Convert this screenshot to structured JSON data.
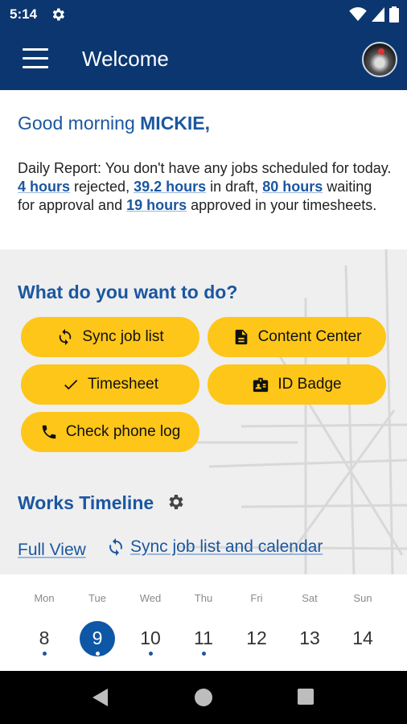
{
  "status_bar": {
    "time": "5:14"
  },
  "app_bar": {
    "title": "Welcome"
  },
  "greeting": {
    "salutation": "Good morning",
    "name": "MICKIE,"
  },
  "daily_report": {
    "intro": "Daily Report:  You don't have any jobs scheduled for today.",
    "rejected_hours": "4 hours",
    "rejected_label": "rejected,",
    "draft_hours": "39.2 hours",
    "draft_label": "in draft,",
    "waiting_hours": "80 hours",
    "waiting_label": "waiting for approval and",
    "approved_hours": "19 hours",
    "approved_label": "approved in your timesheets."
  },
  "actions": {
    "title": "What do you want to do?",
    "buttons": [
      {
        "label": "Sync job list",
        "icon": "sync-icon"
      },
      {
        "label": "Content Center",
        "icon": "document-icon"
      },
      {
        "label": "Timesheet",
        "icon": "check-icon"
      },
      {
        "label": "ID Badge",
        "icon": "badge-icon"
      },
      {
        "label": "Check phone log",
        "icon": "phone-icon"
      }
    ]
  },
  "timeline": {
    "title": "Works Timeline",
    "full_view": "Full View",
    "sync_link": "Sync job list and calendar"
  },
  "calendar": {
    "days": [
      {
        "name": "Mon",
        "num": "8",
        "dot": true
      },
      {
        "name": "Tue",
        "num": "9",
        "dot": true,
        "selected": true
      },
      {
        "name": "Wed",
        "num": "10",
        "dot": true
      },
      {
        "name": "Thu",
        "num": "11",
        "dot": true
      },
      {
        "name": "Fri",
        "num": "12",
        "dot": false
      },
      {
        "name": "Sat",
        "num": "13",
        "dot": false
      },
      {
        "name": "Sun",
        "num": "14",
        "dot": false
      }
    ]
  },
  "colors": {
    "primary": "#0b3670",
    "accent": "#fdc619",
    "link": "#1b57a0"
  }
}
